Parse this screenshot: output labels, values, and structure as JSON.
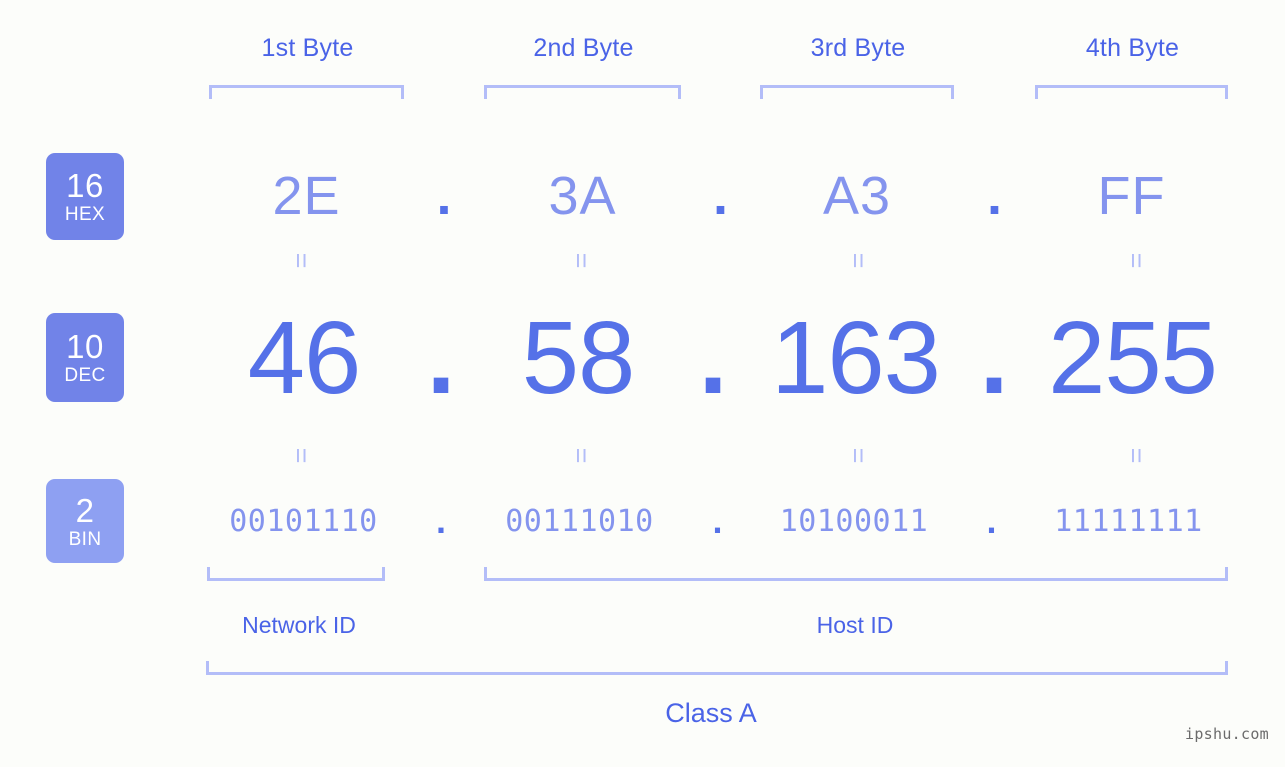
{
  "page": {
    "background_color": "#fcfdfa",
    "watermark": "ipshu.com"
  },
  "colors": {
    "accent_strong": "#5571e8",
    "accent_label": "#4a63e7",
    "accent_light": "#8494ee",
    "bracket": "#b3bdf8",
    "badge_solid": "#7183e8",
    "badge_light": "#8ea0f2"
  },
  "byte_headers": [
    {
      "label": "1st Byte"
    },
    {
      "label": "2nd Byte"
    },
    {
      "label": "3rd Byte"
    },
    {
      "label": "4th Byte"
    }
  ],
  "bases": [
    {
      "id": "hex",
      "number": "16",
      "abbr": "HEX"
    },
    {
      "id": "dec",
      "number": "10",
      "abbr": "DEC"
    },
    {
      "id": "bin",
      "number": "2",
      "abbr": "BIN"
    }
  ],
  "separator": ".",
  "equals_marker": "=",
  "rows": {
    "hex": {
      "values": [
        "2E",
        "3A",
        "A3",
        "FF"
      ]
    },
    "dec": {
      "values": [
        "46",
        "58",
        "163",
        "255"
      ]
    },
    "bin": {
      "values": [
        "00101110",
        "00111010",
        "10100011",
        "11111111"
      ]
    }
  },
  "ip_address": {
    "hex": "2E.3A.A3.FF",
    "dec": "46.58.163.255",
    "bin": "00101110.00111010.10100011.11111111"
  },
  "segments": {
    "network_id": "Network ID",
    "host_id": "Host ID",
    "class": "Class A"
  }
}
